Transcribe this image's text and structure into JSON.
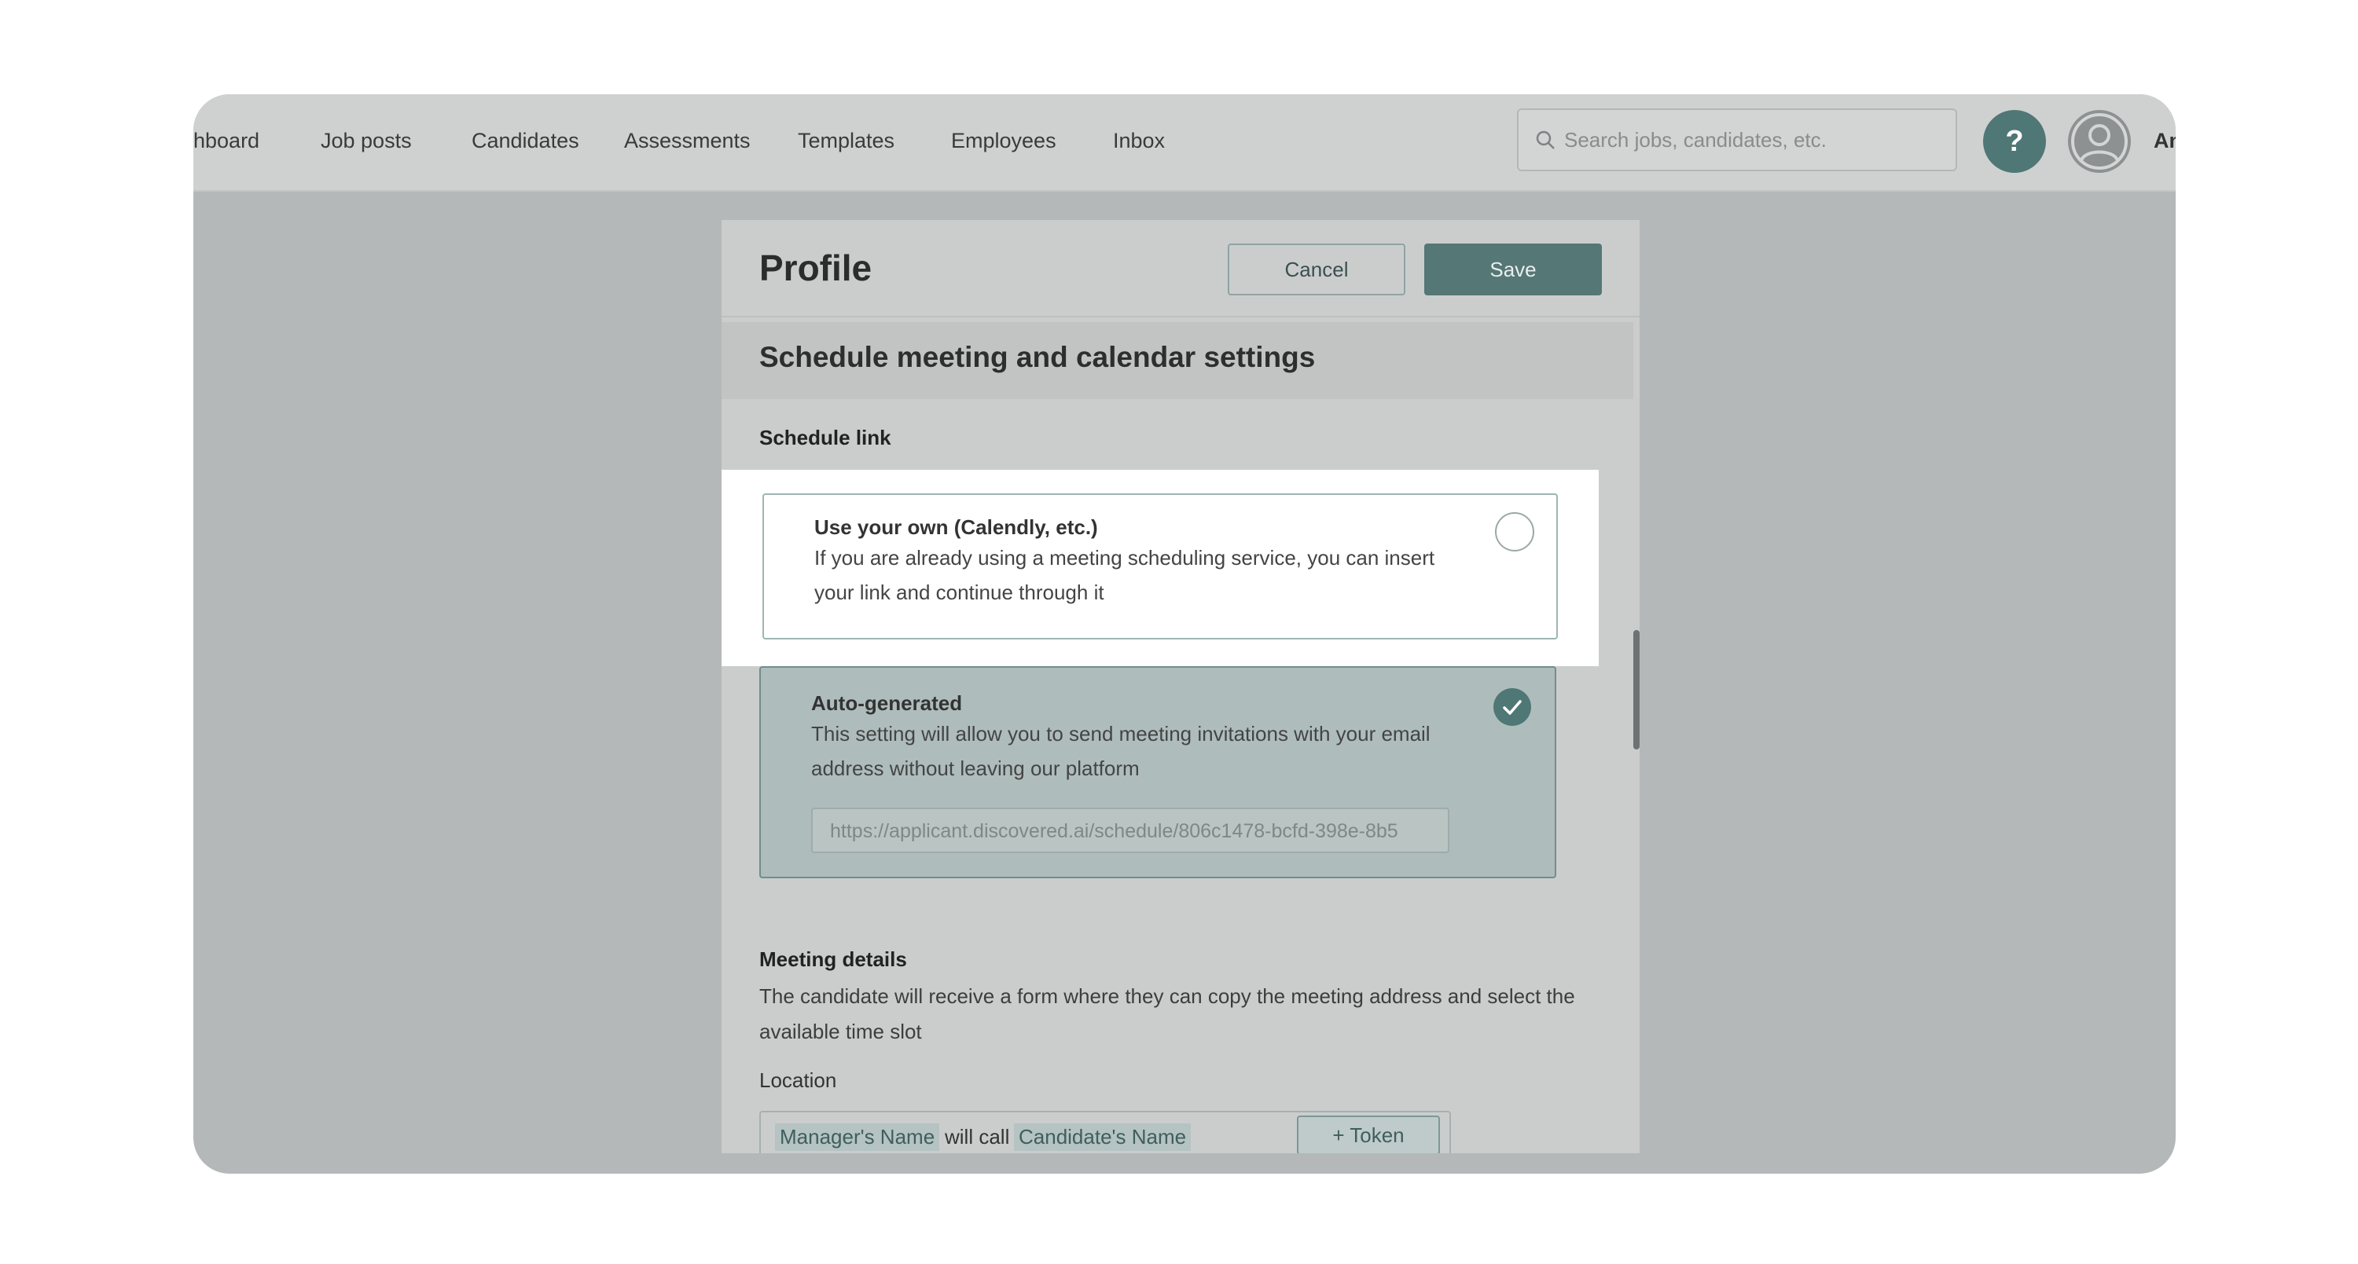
{
  "nav": {
    "items": [
      "hboard",
      "Job posts",
      "Candidates",
      "Assessments",
      "Templates",
      "Employees",
      "Inbox"
    ]
  },
  "search": {
    "placeholder": "Search jobs, candidates, etc."
  },
  "help": {
    "label": "?"
  },
  "user": {
    "name": "An"
  },
  "dialog": {
    "title": "Profile",
    "cancel_label": "Cancel",
    "save_label": "Save",
    "section_title": "Schedule meeting and calendar settings",
    "schedule_link_label": "Schedule link",
    "options": [
      {
        "title": "Use your own (Calendly, etc.)",
        "desc_line1": "If you are already using a meeting scheduling service, you can insert",
        "desc_line2": "your link and continue through it",
        "selected": false
      },
      {
        "title": "Auto-generated",
        "desc_line1": "This setting will allow you to send meeting invitations with your email",
        "desc_line2": "address without leaving our platform",
        "url": "https://applicant.discovered.ai/schedule/806c1478-bcfd-398e-8b5",
        "selected": true
      }
    ],
    "meeting_details": {
      "title": "Meeting details",
      "desc": "The candidate will receive a form where they can copy the meeting address and select the available time slot",
      "location_label": "Location",
      "location": {
        "token1": "Manager's Name",
        "text": "will call",
        "token2": "Candidate's Name",
        "token_button": "Token"
      }
    }
  },
  "colors": {
    "accent": "#4f7775",
    "overlay": "#b5b8b8",
    "highlight": "#ffffff"
  }
}
